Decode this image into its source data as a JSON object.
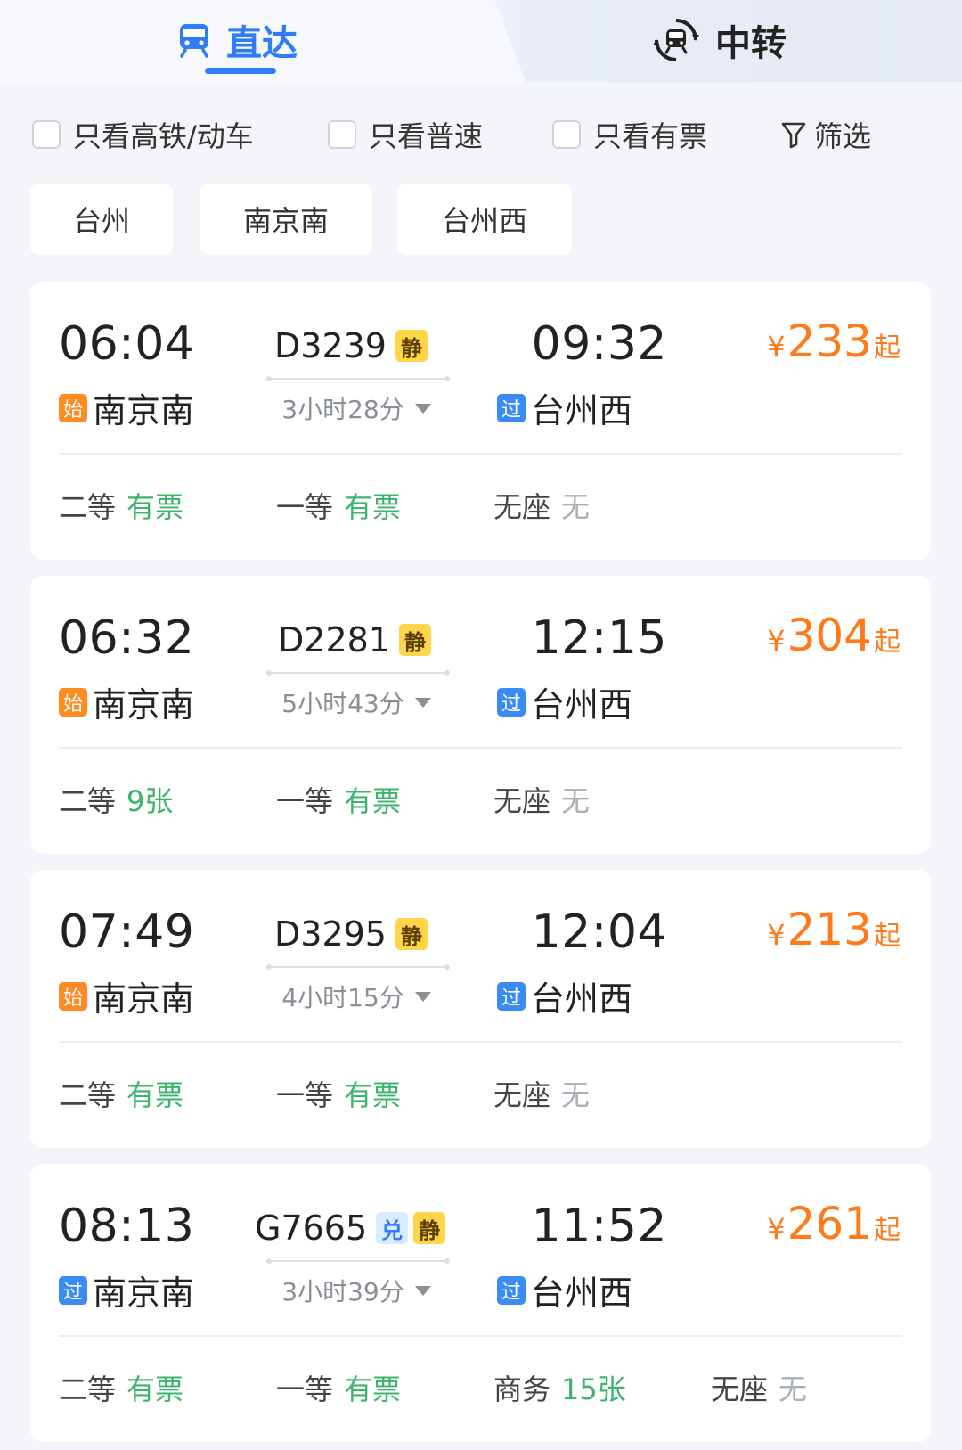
{
  "tabs": {
    "direct_label": "直达",
    "transfer_label": "中转",
    "active": "direct",
    "direct_icon": "train-icon",
    "transfer_icon": "transfer-train-icon",
    "accent_color": "#2f7df6"
  },
  "filters": {
    "high_speed": "只看高铁/动车",
    "normal_speed": "只看普速",
    "available_only": "只看有票",
    "filter": "筛选",
    "filter_icon": "funnel-icon"
  },
  "stations": [
    "台州",
    "南京南",
    "台州西"
  ],
  "colors": {
    "price": "#ff7a1a",
    "available": "#3db46d",
    "unavailable": "#aab0b8",
    "start_tag": "#ff8a1f",
    "pass_tag": "#3a8bf5"
  },
  "trains": [
    {
      "dep_time": "06:04",
      "arr_time": "09:32",
      "train_no": "D3239",
      "badges": [
        "静"
      ],
      "duration": "3小时28分",
      "dep_tag": "始",
      "dep_station": "南京南",
      "arr_tag": "过",
      "arr_station": "台州西",
      "price_symbol": "¥",
      "price": "233",
      "price_suffix": "起",
      "seats": [
        {
          "type": "二等",
          "status": "有票"
        },
        {
          "type": "一等",
          "status": "有票"
        },
        {
          "type": "无座",
          "status": "无"
        }
      ]
    },
    {
      "dep_time": "06:32",
      "arr_time": "12:15",
      "train_no": "D2281",
      "badges": [
        "静"
      ],
      "duration": "5小时43分",
      "dep_tag": "始",
      "dep_station": "南京南",
      "arr_tag": "过",
      "arr_station": "台州西",
      "price_symbol": "¥",
      "price": "304",
      "price_suffix": "起",
      "seats": [
        {
          "type": "二等",
          "status": "9张"
        },
        {
          "type": "一等",
          "status": "有票"
        },
        {
          "type": "无座",
          "status": "无"
        }
      ]
    },
    {
      "dep_time": "07:49",
      "arr_time": "12:04",
      "train_no": "D3295",
      "badges": [
        "静"
      ],
      "duration": "4小时15分",
      "dep_tag": "始",
      "dep_station": "南京南",
      "arr_tag": "过",
      "arr_station": "台州西",
      "price_symbol": "¥",
      "price": "213",
      "price_suffix": "起",
      "seats": [
        {
          "type": "二等",
          "status": "有票"
        },
        {
          "type": "一等",
          "status": "有票"
        },
        {
          "type": "无座",
          "status": "无"
        }
      ]
    },
    {
      "dep_time": "08:13",
      "arr_time": "11:52",
      "train_no": "G7665",
      "badges": [
        "兑",
        "静"
      ],
      "duration": "3小时39分",
      "dep_tag": "过",
      "dep_station": "南京南",
      "arr_tag": "过",
      "arr_station": "台州西",
      "price_symbol": "¥",
      "price": "261",
      "price_suffix": "起",
      "seats": [
        {
          "type": "二等",
          "status": "有票"
        },
        {
          "type": "一等",
          "status": "有票"
        },
        {
          "type": "商务",
          "status": "15张"
        },
        {
          "type": "无座",
          "status": "无"
        }
      ]
    }
  ]
}
